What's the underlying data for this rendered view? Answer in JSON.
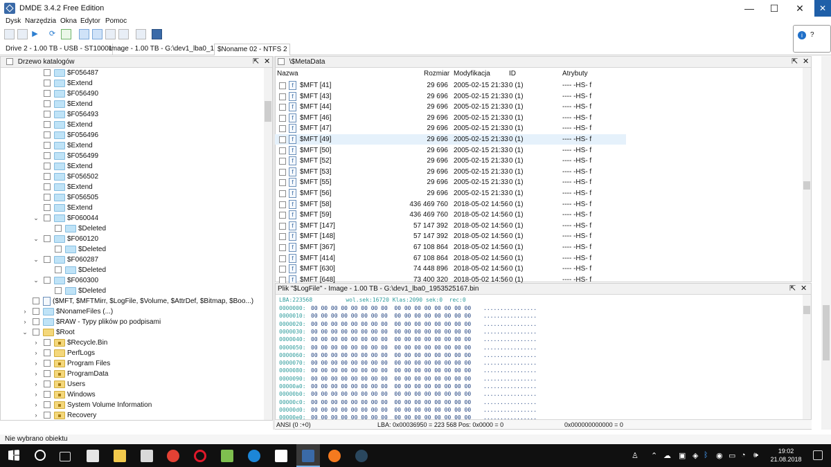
{
  "window": {
    "title": "DMDE 3.4.2 Free Edition"
  },
  "menu": [
    "Dysk",
    "Narzędzia",
    "Okna",
    "Edytor",
    "Pomoc"
  ],
  "tabs": [
    {
      "label": "Drive 2 - 1.00 TB - USB - ST1000L..."
    },
    {
      "label": "Image - 1.00 TB - G:\\dev1_lba0_19..."
    },
    {
      "label": "$Noname 02 - NTFS 2"
    }
  ],
  "tree_panel": {
    "title": "Drzewo katalogów"
  },
  "tree": [
    {
      "text": "$F056487",
      "level": 2,
      "arrow": "",
      "icon": "folder"
    },
    {
      "text": "$Extend",
      "level": 2,
      "arrow": "",
      "icon": "folder"
    },
    {
      "text": "$F056490",
      "level": 2,
      "arrow": "",
      "icon": "folder"
    },
    {
      "text": "$Extend",
      "level": 2,
      "arrow": "",
      "icon": "folder"
    },
    {
      "text": "$F056493",
      "level": 2,
      "arrow": "",
      "icon": "folder"
    },
    {
      "text": "$Extend",
      "level": 2,
      "arrow": "",
      "icon": "folder"
    },
    {
      "text": "$F056496",
      "level": 2,
      "arrow": "",
      "icon": "folder"
    },
    {
      "text": "$Extend",
      "level": 2,
      "arrow": "",
      "icon": "folder"
    },
    {
      "text": "$F056499",
      "level": 2,
      "arrow": "",
      "icon": "folder"
    },
    {
      "text": "$Extend",
      "level": 2,
      "arrow": "",
      "icon": "folder"
    },
    {
      "text": "$F056502",
      "level": 2,
      "arrow": "",
      "icon": "folder"
    },
    {
      "text": "$Extend",
      "level": 2,
      "arrow": "",
      "icon": "folder"
    },
    {
      "text": "$F056505",
      "level": 2,
      "arrow": "",
      "icon": "folder"
    },
    {
      "text": "$Extend",
      "level": 2,
      "arrow": "",
      "icon": "folder"
    },
    {
      "text": "$F060044",
      "level": 2,
      "arrow": "⌄",
      "icon": "folder"
    },
    {
      "text": "$Deleted",
      "level": 3,
      "arrow": "",
      "icon": "folder"
    },
    {
      "text": "$F060120",
      "level": 2,
      "arrow": "⌄",
      "icon": "folder"
    },
    {
      "text": "$Deleted",
      "level": 3,
      "arrow": "",
      "icon": "folder"
    },
    {
      "text": "$F060287",
      "level": 2,
      "arrow": "⌄",
      "icon": "folder"
    },
    {
      "text": "$Deleted",
      "level": 3,
      "arrow": "",
      "icon": "folder"
    },
    {
      "text": "$F060300",
      "level": 2,
      "arrow": "⌄",
      "icon": "folder"
    },
    {
      "text": "$Deleted",
      "level": 3,
      "arrow": "",
      "icon": "folder"
    },
    {
      "text": "($MFT, $MFTMirr, $LogFile, $Volume, $AttrDef, $Bitmap, $Boo...)",
      "level": 1,
      "arrow": "",
      "icon": "files"
    },
    {
      "text": "$NonameFiles (...)",
      "level": 1,
      "arrow": "›",
      "icon": "folder"
    },
    {
      "text": "$RAW - Typy plików po podpisami",
      "level": 1,
      "arrow": "›",
      "icon": "folder"
    },
    {
      "text": "$Root",
      "level": 1,
      "arrow": "⌄",
      "icon": "yellow"
    },
    {
      "text": "$Recycle.Bin",
      "level": 2,
      "arrow": "›",
      "icon": "yellow-lock"
    },
    {
      "text": "PerfLogs",
      "level": 2,
      "arrow": "›",
      "icon": "yellow"
    },
    {
      "text": "Program Files",
      "level": 2,
      "arrow": "›",
      "icon": "yellow-lock"
    },
    {
      "text": "ProgramData",
      "level": 2,
      "arrow": "›",
      "icon": "yellow-lock"
    },
    {
      "text": "Users",
      "level": 2,
      "arrow": "›",
      "icon": "yellow-lock"
    },
    {
      "text": "Windows",
      "level": 2,
      "arrow": "›",
      "icon": "yellow-lock"
    },
    {
      "text": "System Volume Information",
      "level": 2,
      "arrow": "›",
      "icon": "yellow-lock"
    },
    {
      "text": "Recovery",
      "level": 2,
      "arrow": "›",
      "icon": "yellow-lock"
    }
  ],
  "list_panel": {
    "title": "\\$MetaData",
    "columns": [
      "Nazwa",
      "Rozmiar",
      "Modyfikacja",
      "ID",
      "Atrybuty"
    ],
    "rows": [
      [
        "$MFT [41]",
        "29 696",
        "2005-02-15 21:33",
        "0 (1)",
        "---- -HS-  f"
      ],
      [
        "$MFT [43]",
        "29 696",
        "2005-02-15 21:33",
        "0 (1)",
        "---- -HS-  f"
      ],
      [
        "$MFT [44]",
        "29 696",
        "2005-02-15 21:33",
        "0 (1)",
        "---- -HS-  f"
      ],
      [
        "$MFT [46]",
        "29 696",
        "2005-02-15 21:33",
        "0 (1)",
        "---- -HS-  f"
      ],
      [
        "$MFT [47]",
        "29 696",
        "2005-02-15 21:33",
        "0 (1)",
        "---- -HS-  f"
      ],
      [
        "$MFT [49]",
        "29 696",
        "2005-02-15 21:33",
        "0 (1)",
        "---- -HS-  f"
      ],
      [
        "$MFT [50]",
        "29 696",
        "2005-02-15 21:33",
        "0 (1)",
        "---- -HS-  f"
      ],
      [
        "$MFT [52]",
        "29 696",
        "2005-02-15 21:33",
        "0 (1)",
        "---- -HS-  f"
      ],
      [
        "$MFT [53]",
        "29 696",
        "2005-02-15 21:33",
        "0 (1)",
        "---- -HS-  f"
      ],
      [
        "$MFT [55]",
        "29 696",
        "2005-02-15 21:33",
        "0 (1)",
        "---- -HS-  f"
      ],
      [
        "$MFT [56]",
        "29 696",
        "2005-02-15 21:33",
        "0 (1)",
        "---- -HS-  f"
      ],
      [
        "$MFT [58]",
        "436 469 760",
        "2018-05-02 14:56",
        "0 (1)",
        "---- -HS-  f"
      ],
      [
        "$MFT [59]",
        "436 469 760",
        "2018-05-02 14:56",
        "0 (1)",
        "---- -HS-  f"
      ],
      [
        "$MFT [147]",
        "57 147 392",
        "2018-05-02 14:56",
        "0 (1)",
        "---- -HS-  f"
      ],
      [
        "$MFT [148]",
        "57 147 392",
        "2018-05-02 14:56",
        "0 (1)",
        "---- -HS-  f"
      ],
      [
        "$MFT [367]",
        "67 108 864",
        "2018-05-02 14:56",
        "0 (1)",
        "---- -HS-  f"
      ],
      [
        "$MFT [414]",
        "67 108 864",
        "2018-05-02 14:56",
        "0 (1)",
        "---- -HS-  f"
      ],
      [
        "$MFT [630]",
        "74 448 896",
        "2018-05-02 14:56",
        "0 (1)",
        "---- -HS-  f"
      ],
      [
        "$MFT [648]",
        "73 400 320",
        "2018-05-02 14:56",
        "0 (1)",
        "---- -HS-  f"
      ]
    ],
    "selected_row": 5
  },
  "hex_panel": {
    "title": "Plik \"$LogFile\" - Image - 1.00 TB - G:\\dev1_lba0_1953525167.bin",
    "header": "LBA:223568          wol.sek:16720 Klas:2090 sek:0  rec:0",
    "lines": [
      [
        "0000000:",
        "00 00 00 00 00 00 00 00  00 00 00 00 00 00 00 00",
        "................"
      ],
      [
        "0000010:",
        "00 00 00 00 00 00 00 00  00 00 00 00 00 00 00 00",
        "................"
      ],
      [
        "0000020:",
        "00 00 00 00 00 00 00 00  00 00 00 00 00 00 00 00",
        "................"
      ],
      [
        "0000030:",
        "00 00 00 00 00 00 00 00  00 00 00 00 00 00 00 00",
        "................"
      ],
      [
        "0000040:",
        "00 00 00 00 00 00 00 00  00 00 00 00 00 00 00 00",
        "................"
      ],
      [
        "0000050:",
        "00 00 00 00 00 00 00 00  00 00 00 00 00 00 00 00",
        "................"
      ],
      [
        "0000060:",
        "00 00 00 00 00 00 00 00  00 00 00 00 00 00 00 00",
        "................"
      ],
      [
        "0000070:",
        "00 00 00 00 00 00 00 00  00 00 00 00 00 00 00 00",
        "................"
      ],
      [
        "0000080:",
        "00 00 00 00 00 00 00 00  00 00 00 00 00 00 00 00",
        "................"
      ],
      [
        "0000090:",
        "00 00 00 00 00 00 00 00  00 00 00 00 00 00 00 00",
        "................"
      ],
      [
        "00000a0:",
        "00 00 00 00 00 00 00 00  00 00 00 00 00 00 00 00",
        "................"
      ],
      [
        "00000b0:",
        "00 00 00 00 00 00 00 00  00 00 00 00 00 00 00 00",
        "................"
      ],
      [
        "00000c0:",
        "00 00 00 00 00 00 00 00  00 00 00 00 00 00 00 00",
        "................"
      ],
      [
        "00000d0:",
        "00 00 00 00 00 00 00 00  00 00 00 00 00 00 00 00",
        "................"
      ],
      [
        "00000e0:",
        "00 00 00 00 00 00 00 00  00 00 00 00 00 00 00 00",
        "................"
      ]
    ],
    "status": {
      "encoding": "ANSI (0 :+0)",
      "lba": "LBA: 0x00036950 = 223 568  Pos: 0x0000 = 0",
      "value": "0x000000000000 = 0"
    }
  },
  "statusbar": {
    "text": "Nie wybrano obiektu"
  },
  "help": {
    "label": "?"
  },
  "taskbar": {
    "time": "19:02",
    "date": "21.08.2018"
  },
  "colors": {
    "accent": "#3a6aa8",
    "selection": "#e5f1fb",
    "hex_text": "#1a3d7c",
    "hex_offset": "#2f9c9c",
    "taskbar": "#101010"
  }
}
